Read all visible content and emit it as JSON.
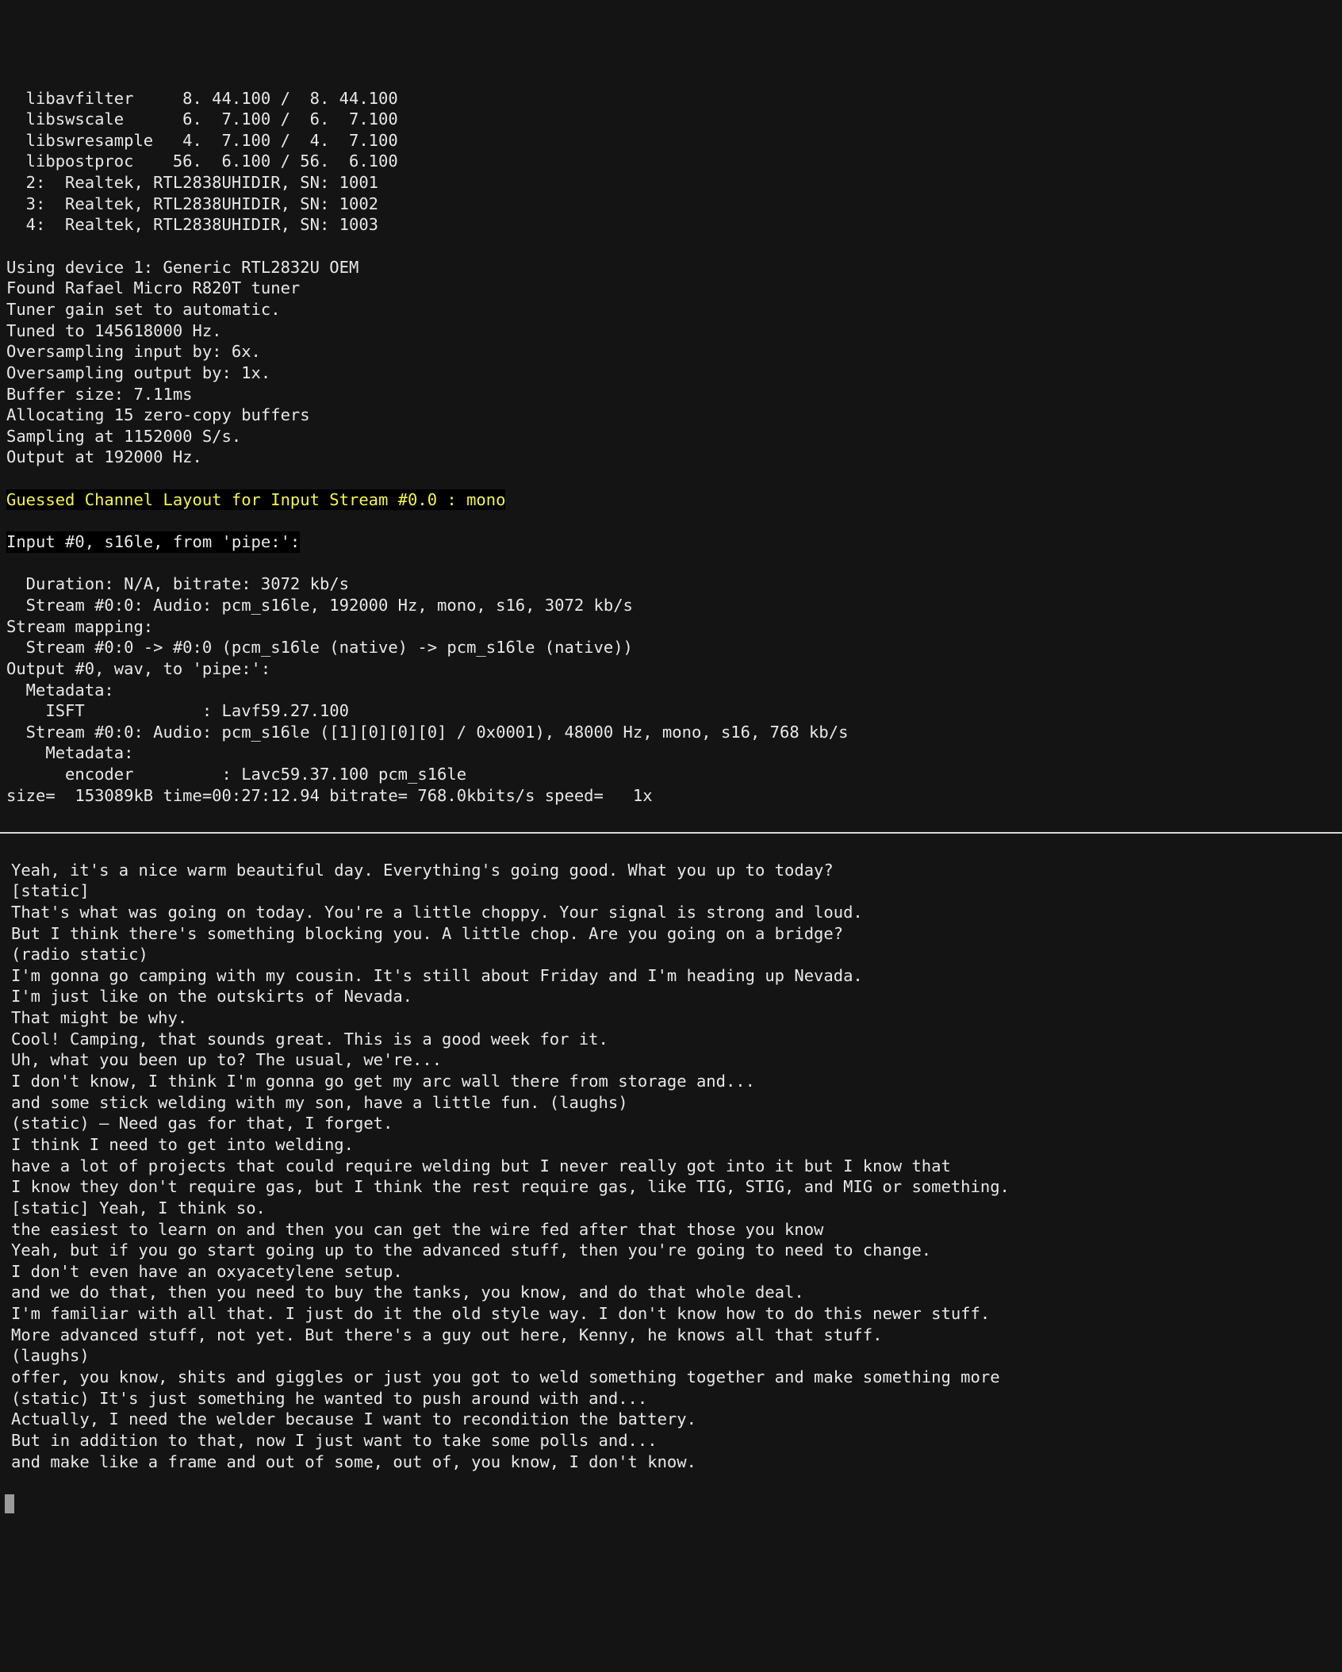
{
  "top_lines": [
    "  libavfilter     8. 44.100 /  8. 44.100",
    "  libswscale      6.  7.100 /  6.  7.100",
    "  libswresample   4.  7.100 /  4.  7.100",
    "  libpostproc    56.  6.100 / 56.  6.100",
    "  2:  Realtek, RTL2838UHIDIR, SN: 1001",
    "  3:  Realtek, RTL2838UHIDIR, SN: 1002",
    "  4:  Realtek, RTL2838UHIDIR, SN: 1003",
    "",
    "Using device 1: Generic RTL2832U OEM",
    "Found Rafael Micro R820T tuner",
    "Tuner gain set to automatic.",
    "Tuned to 145618000 Hz.",
    "Oversampling input by: 6x.",
    "Oversampling output by: 1x.",
    "Buffer size: 7.11ms",
    "Allocating 15 zero-copy buffers",
    "Sampling at 1152000 S/s.",
    "Output at 192000 Hz."
  ],
  "hl_line": "Guessed Channel Layout for Input Stream #0.0 : mono",
  "dark_line": "Input #0, s16le, from 'pipe:':",
  "mid_lines": [
    "  Duration: N/A, bitrate: 3072 kb/s",
    "  Stream #0:0: Audio: pcm_s16le, 192000 Hz, mono, s16, 3072 kb/s",
    "Stream mapping:",
    "  Stream #0:0 -> #0:0 (pcm_s16le (native) -> pcm_s16le (native))",
    "Output #0, wav, to 'pipe:':",
    "  Metadata:",
    "    ISFT            : Lavf59.27.100",
    "  Stream #0:0: Audio: pcm_s16le ([1][0][0][0] / 0x0001), 48000 Hz, mono, s16, 768 kb/s",
    "    Metadata:",
    "      encoder         : Lavc59.37.100 pcm_s16le",
    "size=  153089kB time=00:27:12.94 bitrate= 768.0kbits/s speed=   1x"
  ],
  "transcript": [
    "Yeah, it's a nice warm beautiful day. Everything's going good. What you up to today?",
    "[static]",
    "That's what was going on today. You're a little choppy. Your signal is strong and loud.",
    "But I think there's something blocking you. A little chop. Are you going on a bridge?",
    "(radio static)",
    "I'm gonna go camping with my cousin. It's still about Friday and I'm heading up Nevada.",
    "I'm just like on the outskirts of Nevada.",
    "That might be why.",
    "Cool! Camping, that sounds great. This is a good week for it.",
    "Uh, what you been up to? The usual, we're...",
    "I don't know, I think I'm gonna go get my arc wall there from storage and...",
    "and some stick welding with my son, have a little fun. (laughs)",
    "(static) — Need gas for that, I forget.",
    "I think I need to get into welding.",
    "have a lot of projects that could require welding but I never really got into it but I know that",
    "I know they don't require gas, but I think the rest require gas, like TIG, STIG, and MIG or something.",
    "[static] Yeah, I think so.",
    "the easiest to learn on and then you can get the wire fed after that those you know",
    "Yeah, but if you go start going up to the advanced stuff, then you're going to need to change.",
    "I don't even have an oxyacetylene setup.",
    "and we do that, then you need to buy the tanks, you know, and do that whole deal.",
    "I'm familiar with all that. I just do it the old style way. I don't know how to do this newer stuff.",
    "More advanced stuff, not yet. But there's a guy out here, Kenny, he knows all that stuff.",
    "(laughs)",
    "offer, you know, shits and giggles or just you got to weld something together and make something more",
    "(static) It's just something he wanted to push around with and...",
    "Actually, I need the welder because I want to recondition the battery.",
    "But in addition to that, now I just want to take some polls and...",
    "and make like a frame and out of some, out of, you know, I don't know."
  ]
}
